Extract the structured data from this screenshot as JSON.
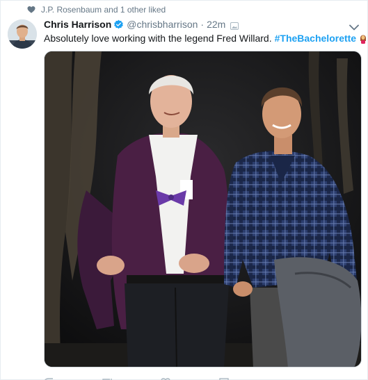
{
  "social_context": {
    "icon": "heart-icon",
    "text": "J.P. Rosenbaum and 1 other liked"
  },
  "tweet": {
    "display_name": "Chris Harrison",
    "verified_icon": "verified-badge-icon",
    "screen_name": "@chrisbharrison",
    "separator": "·",
    "timestamp": "22m",
    "text": "Absolutely love working with the legend Fred Willard.",
    "hashtag": "#TheBachelorette",
    "emoji": "woman-emoji",
    "media_icon": "photo"
  },
  "actions": [
    "reply-icon",
    "retweet-icon",
    "like-icon",
    "dm-icon"
  ],
  "colors": {
    "accent": "#1da1f2",
    "secondary_text": "#657786",
    "primary_text": "#14171a"
  }
}
